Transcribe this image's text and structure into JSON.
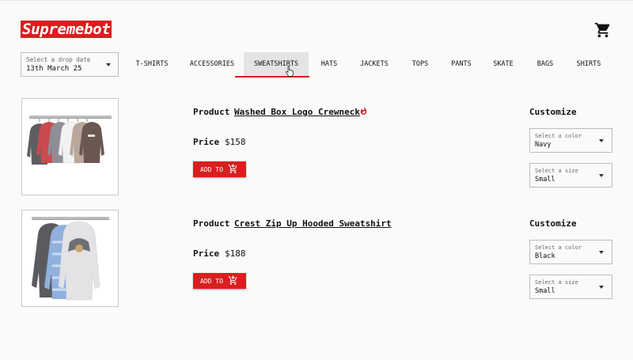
{
  "brand": {
    "name": "Supremebot",
    "accent": "#d81f1f"
  },
  "header": {
    "cart_icon": "cart-icon"
  },
  "drop_date": {
    "label": "Select a drop date",
    "value": "13th March 25"
  },
  "categories": [
    {
      "label": "T-SHIRTS"
    },
    {
      "label": "ACCESSORIES"
    },
    {
      "label": "SWEATSHIRTS",
      "active": true
    },
    {
      "label": "HATS"
    },
    {
      "label": "JACKETS"
    },
    {
      "label": "TOPS"
    },
    {
      "label": "PANTS"
    },
    {
      "label": "SKATE"
    },
    {
      "label": "BAGS"
    },
    {
      "label": "SHIRTS"
    }
  ],
  "products": [
    {
      "product_label": "Product",
      "name": "Washed Box Logo Crewneck",
      "hot": true,
      "price_label": "Price",
      "price": "$158",
      "add_label": "ADD TO",
      "customize_label": "Customize",
      "color": {
        "label": "Select a color",
        "value": "Navy"
      },
      "size": {
        "label": "Select a size",
        "value": "Small"
      }
    },
    {
      "product_label": "Product",
      "name": "Crest Zip Up Hooded Sweatshirt",
      "hot": false,
      "price_label": "Price",
      "price": "$188",
      "add_label": "ADD TO",
      "customize_label": "Customize",
      "color": {
        "label": "Select a color",
        "value": "Black"
      },
      "size": {
        "label": "Select a size",
        "value": "Small"
      }
    }
  ]
}
